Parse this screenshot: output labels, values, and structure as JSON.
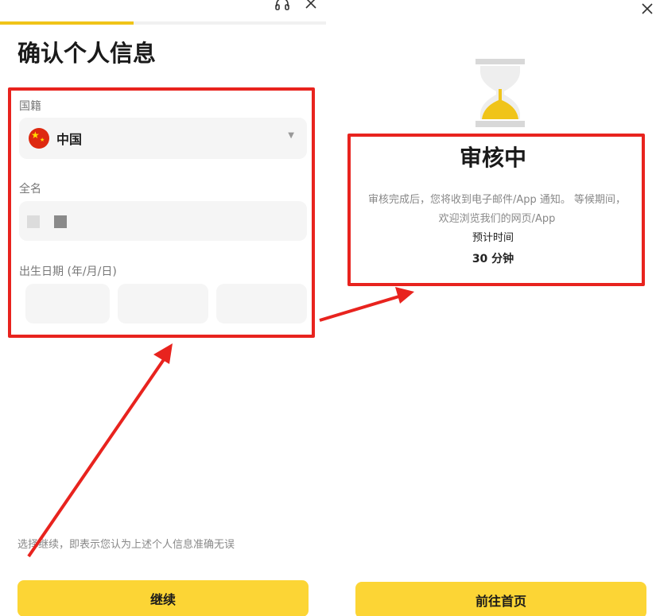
{
  "colors": {
    "accent": "#fcd535",
    "progress": "#f0c419",
    "annotation_red": "#e8231e",
    "field_bg": "#f5f5f5"
  },
  "left_screen": {
    "progress_fraction": 0.41,
    "header_icons": [
      "headset-icon",
      "close-icon"
    ],
    "title": "确认个人信息",
    "nationality": {
      "label": "国籍",
      "value": "中国",
      "flag_icon": "china-flag-icon",
      "dropdown_icon": "triangle-down-icon"
    },
    "full_name": {
      "label": "全名"
    },
    "birth_date": {
      "label": "出生日期 (年/月/日)"
    },
    "disclaimer": "选择继续，即表示您认为上述个人信息准确无误",
    "continue_button": "继续"
  },
  "right_screen": {
    "close_icon": "close-icon",
    "hourglass_icon": "hourglass-icon",
    "status_title": "审核中",
    "description_line1": "审核完成后，您将收到电子邮件/App 通知。 等候期间，",
    "description_line2": "欢迎浏览我们的网页/App",
    "eta_label": "预计时间",
    "eta_value": "30 分钟",
    "home_button": "前往首页"
  }
}
